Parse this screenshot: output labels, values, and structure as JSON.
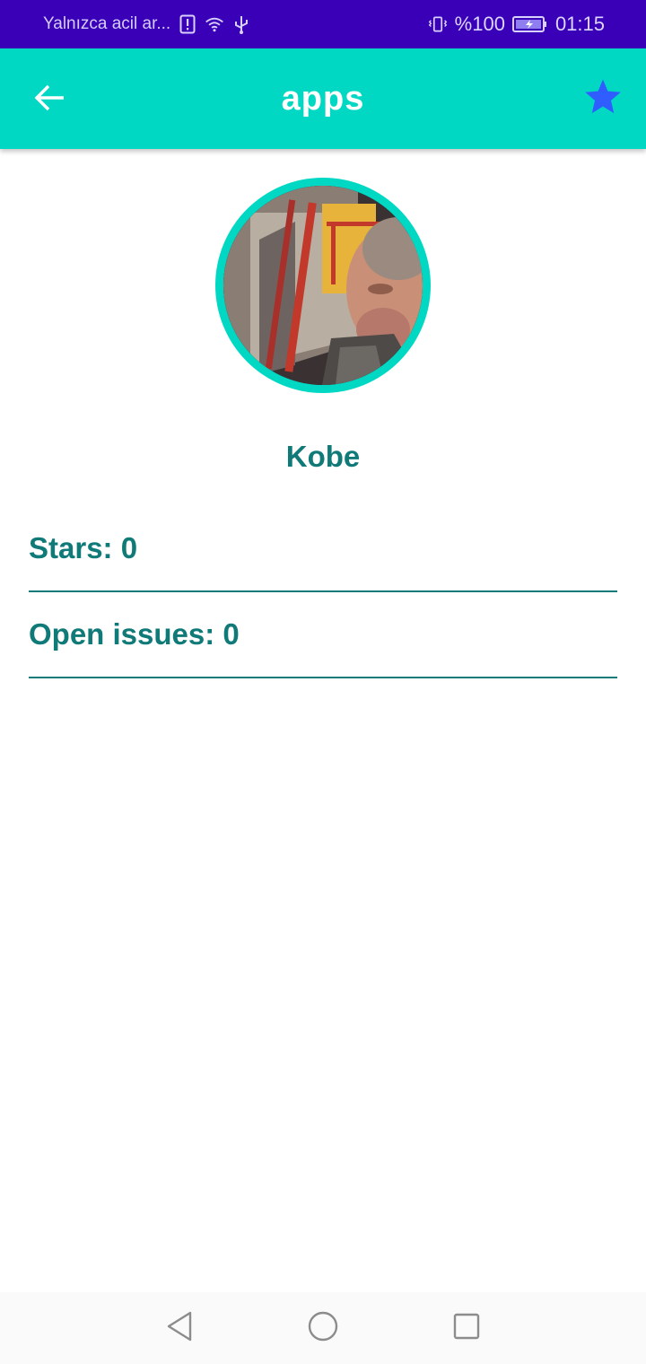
{
  "status_bar": {
    "carrier_text": "Yalnızca acil ar...",
    "battery_percent": "%100",
    "time": "01:15",
    "icons": [
      "alert-icon",
      "wifi-icon",
      "usb-icon",
      "vibrate-icon",
      "battery-charging-icon"
    ]
  },
  "app_bar": {
    "title": "apps",
    "back_icon": "arrow-back-icon",
    "favorite_icon": "star-icon",
    "background_color": "#00d8c4",
    "star_color": "#2f5dff"
  },
  "owner": {
    "name": "Kobe",
    "avatar_icon": "avatar-photo"
  },
  "details": {
    "stars_label": "Stars: 0",
    "open_issues_label": "Open issues: 0"
  },
  "nav_bar": {
    "buttons": [
      "nav-back-icon",
      "nav-home-icon",
      "nav-recents-icon"
    ]
  },
  "colors": {
    "status_bar": "#3a00b8",
    "text_teal": "#107a78"
  }
}
